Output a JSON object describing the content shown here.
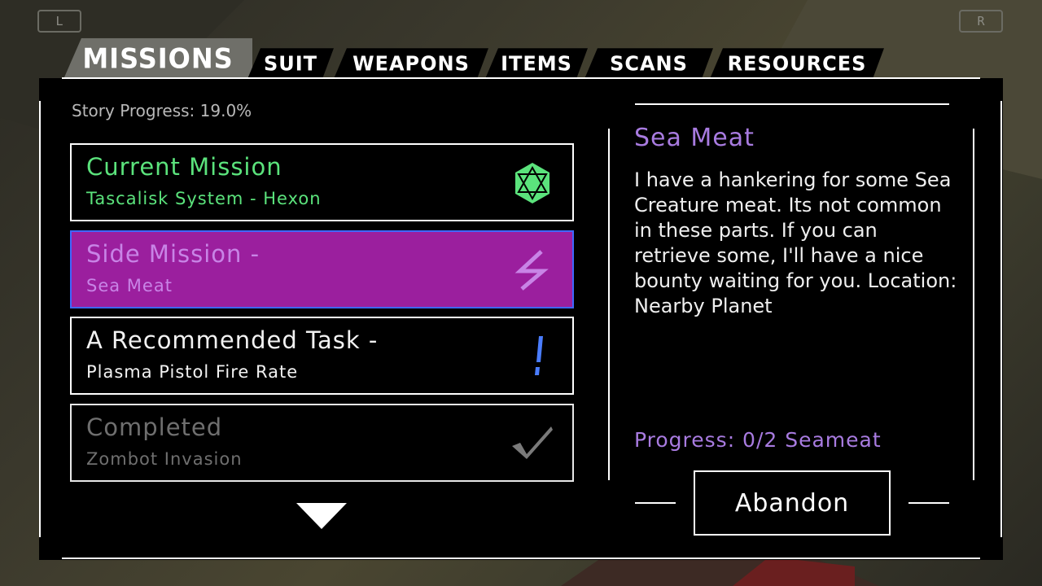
{
  "shoulders": {
    "left": "L",
    "right": "R"
  },
  "tabs": [
    {
      "label": "MISSIONS"
    },
    {
      "label": "SUIT"
    },
    {
      "label": "WEAPONS"
    },
    {
      "label": "ITEMS"
    },
    {
      "label": "SCANS"
    },
    {
      "label": "RESOURCES"
    }
  ],
  "story_progress": "Story Progress: 19.0%",
  "missions": [
    {
      "title": "Current Mission",
      "subtitle": "Tascalisk System - Hexon",
      "icon": "hexagon-planet-icon",
      "color": "#5be37c"
    },
    {
      "title": "Side Mission -",
      "subtitle": "Sea Meat",
      "icon": "lightning-icon",
      "color": "#c884e6"
    },
    {
      "title": "A Recommended Task -",
      "subtitle": "Plasma Pistol Fire Rate",
      "icon": "exclamation-icon",
      "color": "#4a7dff"
    },
    {
      "title": "Completed",
      "subtitle": "Zombot Invasion",
      "icon": "checkmark-icon",
      "color": "#6f6f6f"
    }
  ],
  "detail": {
    "title": "Sea Meat",
    "description": "I have a hankering for some Sea Creature meat. Its not common in these parts. If you can retrieve some, I'll have a nice bounty waiting for you. Location: Nearby Planet",
    "progress": "Progress: 0/2 Seameat",
    "abandon_label": "Abandon"
  },
  "colors": {
    "accent_purple": "#a87be0",
    "selected_bg": "#9b1f9e",
    "selected_border": "#3f67ff",
    "current_green": "#5be37c"
  }
}
